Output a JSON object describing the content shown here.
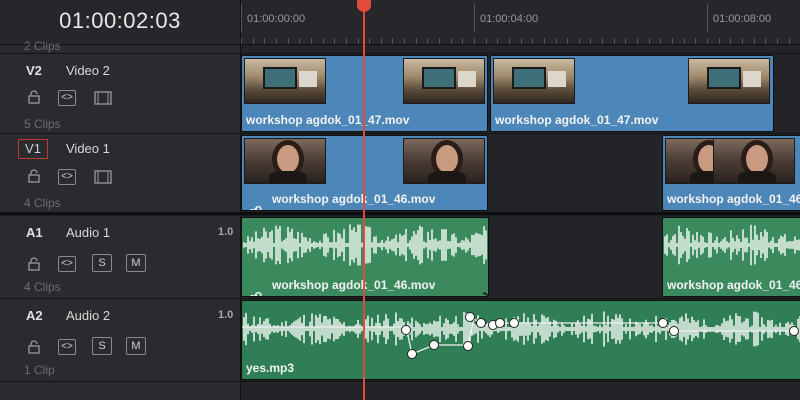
{
  "timecode": "01:00:02:03",
  "ruler": {
    "labels": [
      "01:00:00:00",
      "01:00:04:00",
      "01:00:08:00"
    ]
  },
  "above_clip_count": "2 Clips",
  "tracks": {
    "v2": {
      "id": "V2",
      "name": "Video 2",
      "clip_count": "5 Clips"
    },
    "v1": {
      "id": "V1",
      "name": "Video 1",
      "clip_count": "4 Clips"
    },
    "a1": {
      "id": "A1",
      "name": "Audio 1",
      "volume": "1.0",
      "clip_count": "4 Clips",
      "solo": "S",
      "mute": "M"
    },
    "a2": {
      "id": "A2",
      "name": "Audio 2",
      "volume": "1.0",
      "clip_count": "1 Clip",
      "solo": "S",
      "mute": "M"
    }
  },
  "clips": {
    "v2_a": "workshop agdok_01_47.mov",
    "v2_b": "workshop agdok_01_47.mov",
    "v1_a": "workshop agdok_01_46.mov",
    "v1_b": "workshop agdok_01_46.mov",
    "a1_a": "workshop agdok_01_46.mov",
    "a1_b": "workshop agdok_01_46.mov",
    "a2": "yes.mp3"
  },
  "colors": {
    "video_clip": "#4d86b8",
    "audio_clip": "#3a8a5d",
    "playhead": "#e24a3b",
    "waveform": "#e6f2ea"
  },
  "icons": [
    "lock-icon",
    "link-clips-icon",
    "film-icon",
    "chain-link-icon",
    "fade-curve-icon"
  ]
}
